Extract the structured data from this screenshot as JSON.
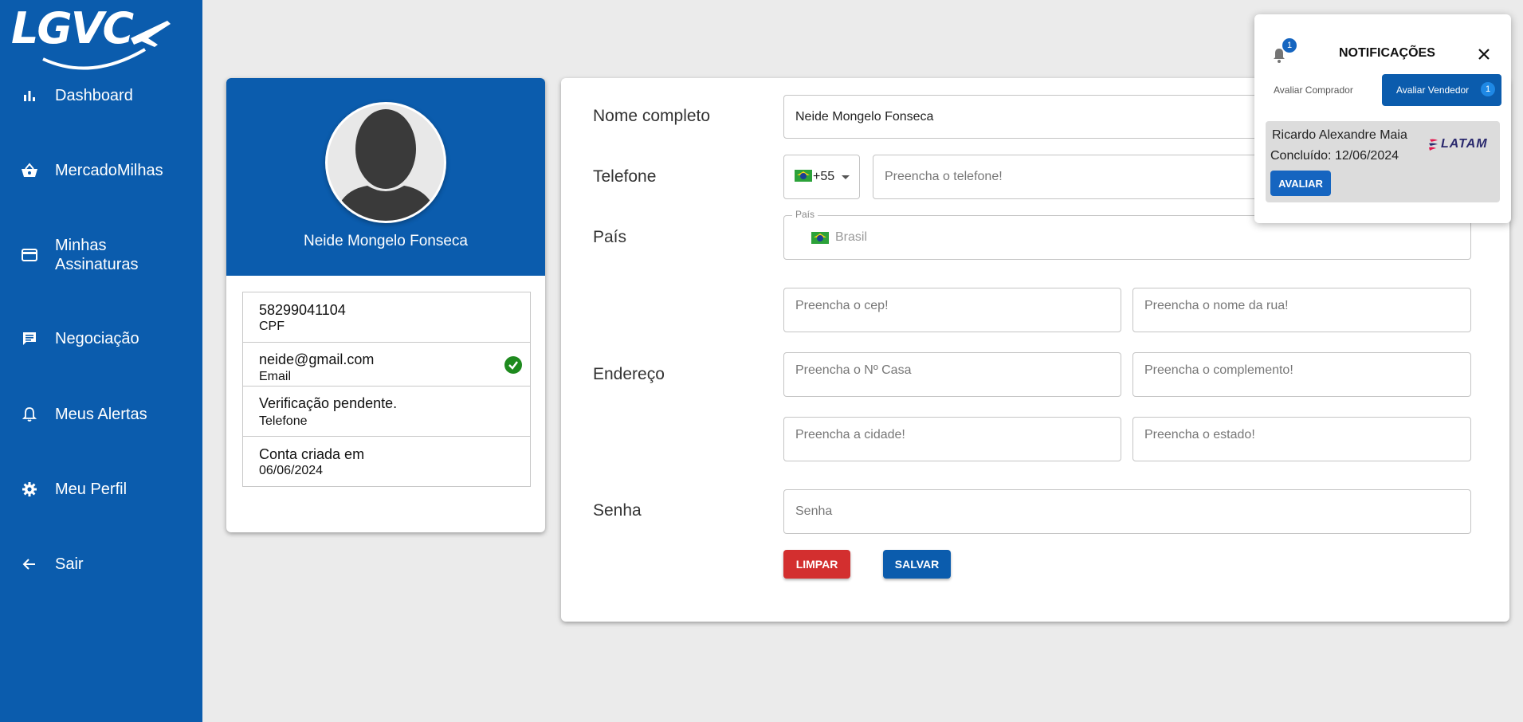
{
  "brand": {
    "logo_text": "LGVC"
  },
  "sidebar": {
    "items": [
      {
        "label": "Dashboard",
        "icon": "bar-chart-icon"
      },
      {
        "label": "MercadoMilhas",
        "icon": "basket-icon"
      },
      {
        "label": "Minhas Assinaturas",
        "icon": "credit-card-icon"
      },
      {
        "label": "Negociação",
        "icon": "chat-icon"
      },
      {
        "label": "Meus Alertas",
        "icon": "bell-icon"
      },
      {
        "label": "Meu Perfil",
        "icon": "gear-icon"
      },
      {
        "label": "Sair",
        "icon": "arrow-left-icon"
      }
    ]
  },
  "profile": {
    "name": "Neide Mongelo Fonseca",
    "info": [
      {
        "value": "58299041104",
        "label": "CPF"
      },
      {
        "value": "neide@gmail.com",
        "label": "Email",
        "verified": true
      },
      {
        "value": "Verificação pendente.",
        "label": "Telefone"
      },
      {
        "value": "Conta criada em",
        "label": "06/06/2024"
      }
    ]
  },
  "form": {
    "labels": {
      "name": "Nome completo",
      "phone": "Telefone",
      "country": "País",
      "address": "Endereço",
      "password": "Senha"
    },
    "name_value": "Neide Mongelo Fonseca",
    "phone_code": "+55",
    "phone_placeholder": "Preencha o telefone!",
    "country_legend": "País",
    "country_value": "Brasil",
    "address": {
      "cep": "Preencha o cep!",
      "street": "Preencha o nome da rua!",
      "number": "Preencha o Nº Casa",
      "complement": "Preencha o complemento!",
      "city": "Preencha a cidade!",
      "state": "Preencha o estado!"
    },
    "password_placeholder": "Senha",
    "buttons": {
      "clear": "LIMPAR",
      "save": "SALVAR"
    }
  },
  "notifications": {
    "title": "NOTIFICAÇÕES",
    "bell_count": "1",
    "tabs": {
      "buyer": "Avaliar Comprador",
      "seller": "Avaliar Vendedor",
      "seller_count": "1"
    },
    "item": {
      "name": "Ricardo Alexandre Maia",
      "date": "Concluído: 12/06/2024",
      "airline": "LATAM",
      "button": "AVALIAR"
    }
  },
  "colors": {
    "primary": "#0b5cad",
    "danger": "#d32f2f",
    "background": "#ebebeb",
    "success": "#1e8a1e"
  }
}
